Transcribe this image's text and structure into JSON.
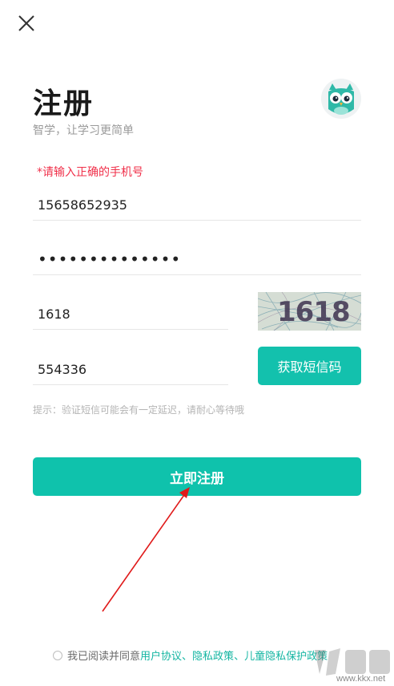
{
  "header": {
    "close_icon": "close-icon",
    "title": "注册",
    "subtitle": "智学，让学习更简单",
    "logo_icon": "owl-logo-icon"
  },
  "form": {
    "error_message": "*请输入正确的手机号",
    "phone_value": "15658652935",
    "password_value": "••••••••••••••",
    "captcha_value": "1618",
    "captcha_image_text": "1618",
    "sms_code_value": "554336",
    "sms_button_label": "获取短信码",
    "hint": "提示：验证短信可能会有一定延迟，请耐心等待哦",
    "register_button_label": "立即注册"
  },
  "agreement": {
    "prefix": "我已阅读并同意",
    "user_agreement": "用户协议",
    "sep1": "、",
    "privacy_policy": "隐私政策",
    "sep2": "、",
    "children_privacy_policy": "儿童隐私保护政策"
  },
  "watermark": {
    "text": "www.kkx.net"
  },
  "colors": {
    "accent": "#0fc2ac",
    "error": "#f0304a",
    "annotation_arrow": "#e01a1a"
  }
}
